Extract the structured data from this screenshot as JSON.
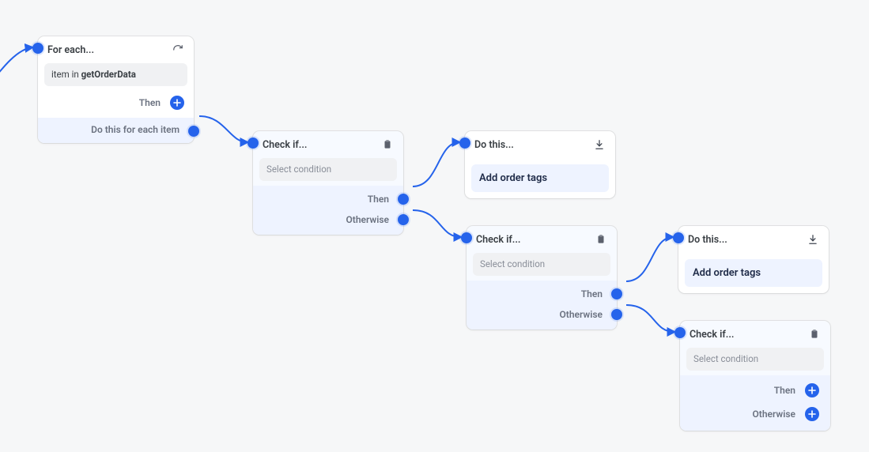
{
  "foreach": {
    "title": "For each...",
    "item_prefix": "item in ",
    "item_source": "getOrderData",
    "then_label": "Then",
    "footer_label": "Do this for each item"
  },
  "check": {
    "title": "Check if...",
    "placeholder": "Select condition",
    "then_label": "Then",
    "otherwise_label": "Otherwise"
  },
  "dothis": {
    "title": "Do this...",
    "action": "Add order tags"
  },
  "colors": {
    "accent": "#2563eb"
  }
}
